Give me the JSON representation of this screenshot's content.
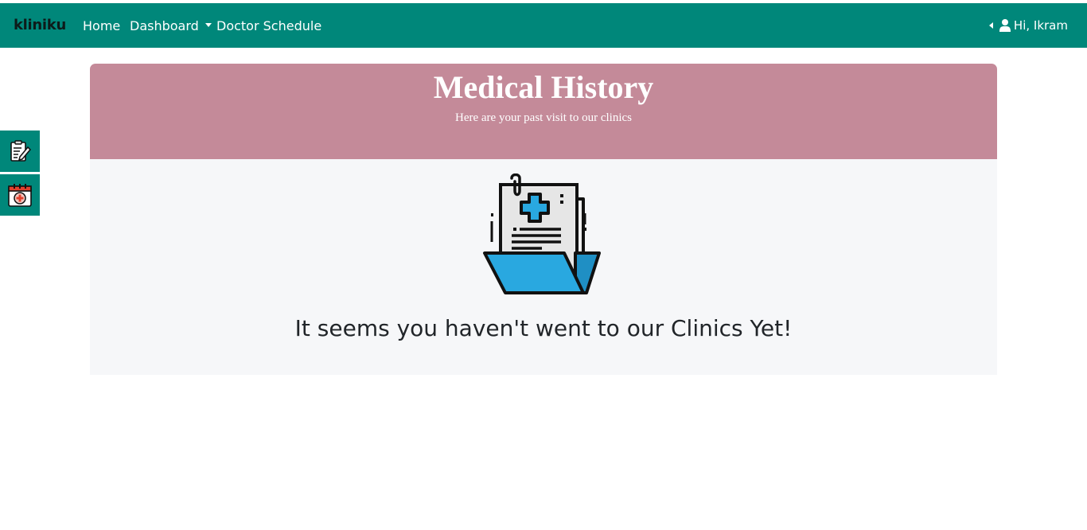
{
  "navbar": {
    "brand": "kliniku",
    "links": [
      {
        "label": "Home"
      },
      {
        "label": "Dashboard"
      },
      {
        "label": "Doctor Schedule"
      }
    ],
    "user_greeting": "Hi, Ikram"
  },
  "sidebar": {
    "items": [
      {
        "icon": "clipboard-edit-icon"
      },
      {
        "icon": "calendar-medical-icon"
      }
    ]
  },
  "header": {
    "title": "Medical History",
    "subtitle": "Here are your past visit to our clinics"
  },
  "empty_state": {
    "icon": "medical-folder-icon",
    "message": "It seems you haven't went to our Clinics Yet!"
  },
  "colors": {
    "navbar": "#00877a",
    "header": "#c48a99",
    "panel": "#f6f7f9",
    "folder": "#29a8e0"
  }
}
